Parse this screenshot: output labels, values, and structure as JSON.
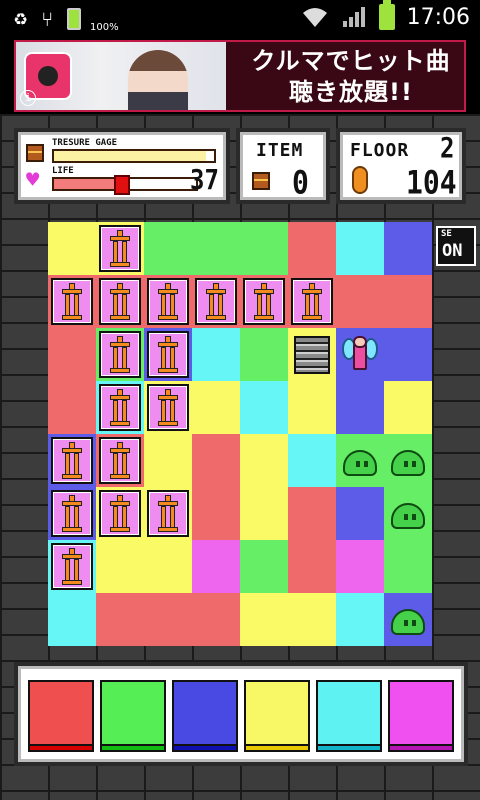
{
  "status_bar": {
    "time": "17:06",
    "battery_small_label": "100%"
  },
  "ad": {
    "line1": "クルマでヒット曲",
    "line2": "聴き放題!!",
    "info": "i"
  },
  "hud": {
    "treasure_label": "TRESURE GAGE",
    "treasure_level": 0.95,
    "life_label": "LIFE",
    "life_value": "37",
    "life_level": 0.48,
    "item_label": "ITEM",
    "item_count": "0",
    "floor_label": "FLOOR",
    "floor_value": "2",
    "coin_count": "104"
  },
  "se_toggle": {
    "label": "SE",
    "state": "ON"
  },
  "colors": {
    "red": "#ef6b6b",
    "green": "#66ee66",
    "blue": "#5c5ce8",
    "yellow": "#fafa66",
    "cyan": "#66f6f6",
    "magenta": "#ee66ee"
  },
  "board": {
    "rows": [
      [
        "yellow",
        "yellow",
        "green",
        "green",
        "green",
        "red",
        "cyan",
        "blue"
      ],
      [
        "red",
        "red",
        "red",
        "red",
        "red",
        "red",
        "red",
        "red"
      ],
      [
        "red",
        "green",
        "blue",
        "cyan",
        "green",
        "yellow",
        "blue",
        "blue"
      ],
      [
        "red",
        "cyan",
        "yellow",
        "yellow",
        "cyan",
        "yellow",
        "blue",
        "yellow"
      ],
      [
        "blue",
        "red",
        "yellow",
        "red",
        "yellow",
        "cyan",
        "green",
        "green"
      ],
      [
        "blue",
        "yellow",
        "yellow",
        "red",
        "yellow",
        "red",
        "blue",
        "green"
      ],
      [
        "cyan",
        "yellow",
        "yellow",
        "magenta",
        "green",
        "red",
        "magenta",
        "green"
      ],
      [
        "cyan",
        "red",
        "red",
        "red",
        "yellow",
        "yellow",
        "cyan",
        "blue"
      ]
    ],
    "posts": [
      [
        0,
        1
      ],
      [
        1,
        0
      ],
      [
        1,
        1
      ],
      [
        1,
        2
      ],
      [
        1,
        3
      ],
      [
        1,
        4
      ],
      [
        1,
        5
      ],
      [
        2,
        1
      ],
      [
        2,
        2
      ],
      [
        3,
        1
      ],
      [
        3,
        2
      ],
      [
        4,
        0
      ],
      [
        4,
        1
      ],
      [
        5,
        0
      ],
      [
        5,
        1
      ],
      [
        5,
        2
      ],
      [
        6,
        0
      ]
    ],
    "slimes": [
      [
        4,
        6
      ],
      [
        4,
        7
      ],
      [
        5,
        7
      ],
      [
        7,
        7
      ]
    ],
    "stairs": [
      2,
      5
    ],
    "fairy": [
      2,
      6
    ]
  },
  "palette": [
    "red",
    "green",
    "blue",
    "yellow",
    "cyan",
    "magenta"
  ],
  "palette_colors": {
    "red": "#ef4f4f",
    "green": "#55ee55",
    "blue": "#4949e4",
    "yellow": "#f8f866",
    "cyan": "#5ef2f2",
    "magenta": "#f050f0"
  },
  "palette_bars": {
    "red": "#d60000",
    "green": "#11bb11",
    "blue": "#1010b0",
    "yellow": "#e8c800",
    "cyan": "#12b4c8",
    "magenta": "#b414b4"
  }
}
